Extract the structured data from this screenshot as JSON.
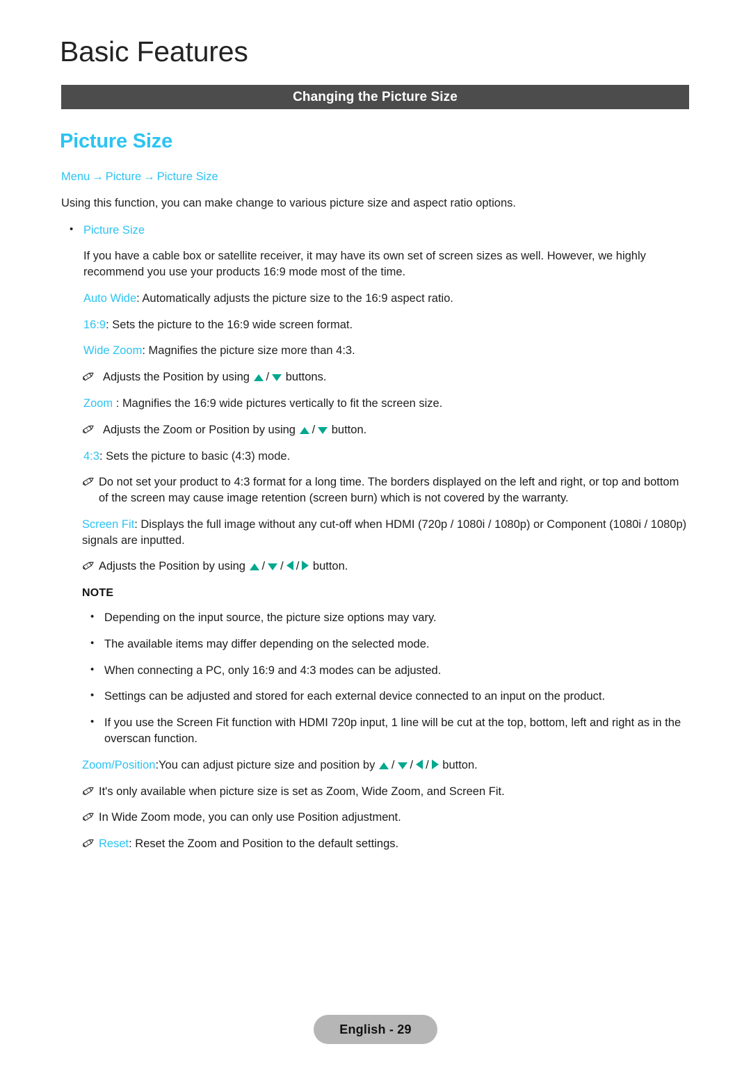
{
  "header": {
    "chapter_title": "Basic Features",
    "section_bar_title": "Changing the Picture Size",
    "bar_color": "#4c4c4c"
  },
  "colors": {
    "accent_cyan": "#2cc3f2",
    "arrow_green": "#00a88e",
    "bar_gray": "#4c4c4c",
    "footer_gray": "#b6b6b6"
  },
  "main": {
    "page_heading": "Picture Size",
    "breadcrumb": {
      "item1": "Menu",
      "item2": "Picture",
      "item3": "Picture Size",
      "arrow": "→"
    },
    "intro": "Using this function, you can make change to various picture size and aspect ratio options.",
    "bullet_picture_size": "Picture Size",
    "cable_box_para": "If you have a cable box or satellite receiver, it may have its own set of screen sizes as well. However, we highly recommend you use your products 16:9 mode most of the time.",
    "modes": {
      "auto_wide_key": "Auto Wide",
      "auto_wide_desc": ": Automatically adjusts the picture size to the 16:9 aspect ratio.",
      "sixteen_nine_key": "16:9",
      "sixteen_nine_desc": ": Sets the picture to the 16:9 wide screen format.",
      "wide_zoom_key": "Wide Zoom",
      "wide_zoom_desc": ": Magnifies the picture size more than 4:3.",
      "wide_zoom_note_pre": "Adjusts the Position by using ",
      "wide_zoom_note_post": " buttons.",
      "zoom_key": "Zoom",
      "zoom_desc": " : Magnifies the 16:9 wide pictures vertically to fit the screen size.",
      "zoom_note_pre": "Adjusts the Zoom or Position by using ",
      "zoom_note_post": " button.",
      "four_three_key": "4:3",
      "four_three_desc": ": Sets the picture to basic (4:3) mode.",
      "four_three_note": "Do not set your product to 4:3 format for a long time. The borders displayed on the left and right, or top and bottom of the screen may cause image retention (screen burn) which is not covered by the warranty.",
      "screen_fit_key": "Screen Fit",
      "screen_fit_desc": ": Displays the full image without any cut-off when HDMI (720p / 1080i / 1080p) or Component (1080i / 1080p) signals are inputted.",
      "screen_fit_note_pre": "Adjusts the Position by using ",
      "screen_fit_note_post": " button."
    },
    "note_section": {
      "heading": "NOTE",
      "items": [
        "Depending on the input source, the picture size options may vary.",
        "The available items may differ depending on the selected mode.",
        "When connecting a PC, only 16:9 and 4:3 modes can be adjusted.",
        "Settings can be adjusted and stored for each external device connected to an input on the product.",
        "If you use the Screen Fit function with HDMI 720p input, 1 line will be cut at the top, bottom, left and right as in the overscan function."
      ]
    },
    "zoom_position": {
      "key": "Zoom/Position",
      "desc_pre": ":You can adjust picture size and position by ",
      "desc_post": " button.",
      "note1": "It's only available when picture size is set as Zoom, Wide Zoom, and Screen Fit.",
      "note2": "In Wide Zoom mode, you can only use Position adjustment.",
      "reset_key": "Reset",
      "reset_desc": ": Reset the Zoom and Position to the default settings."
    }
  },
  "footer": {
    "label": "English - 29"
  }
}
